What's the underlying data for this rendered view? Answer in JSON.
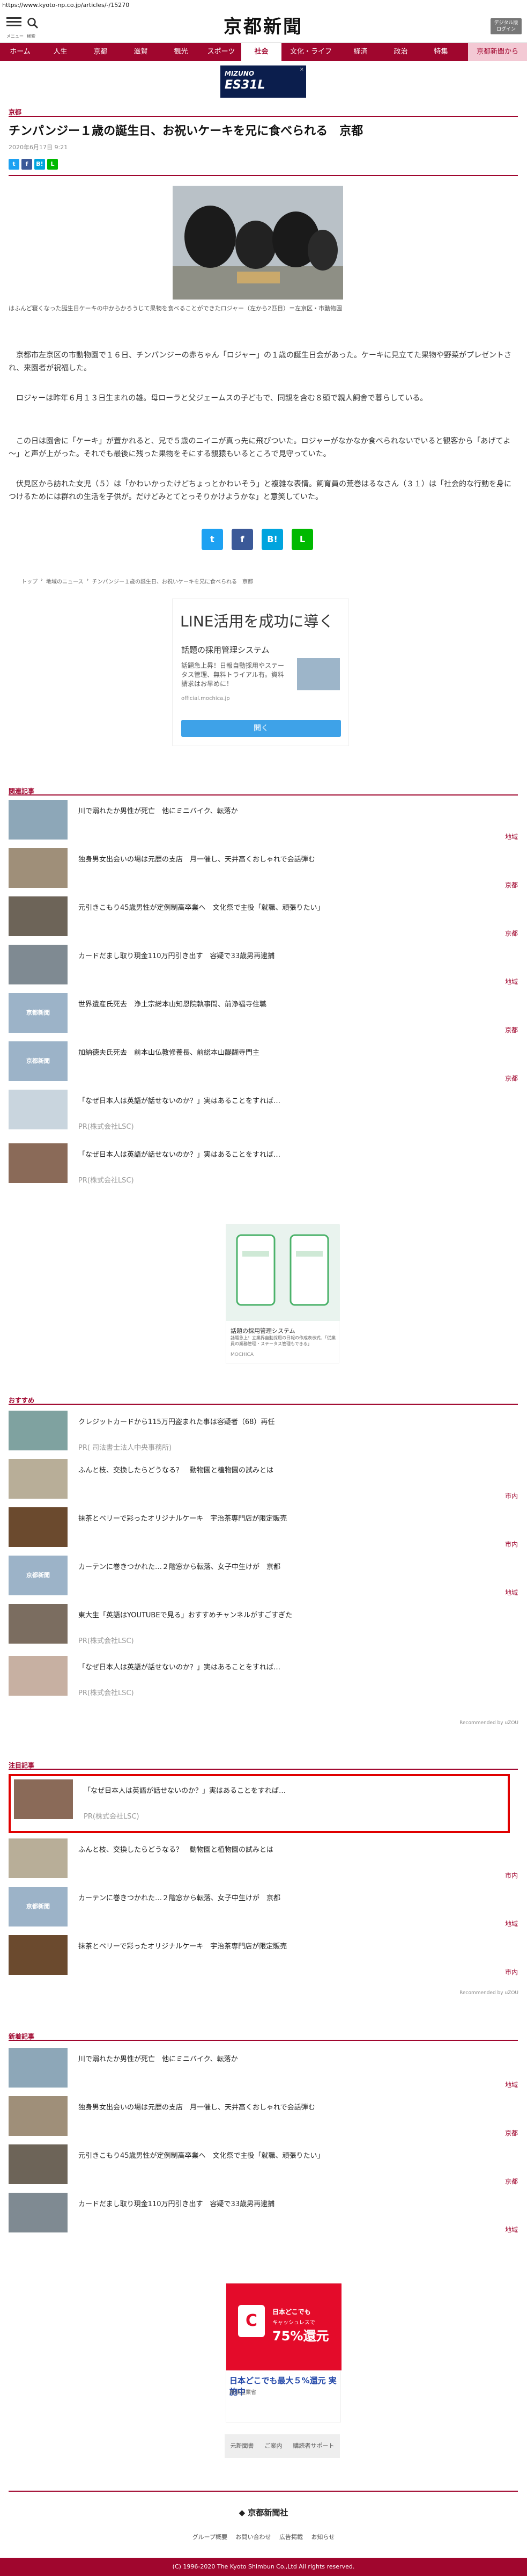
{
  "url": "https://www.kyoto-np.co.jp/articles/-/15270",
  "header": {
    "menu_label": "メニュー",
    "search_label": "検索",
    "logo_text": "京都新聞",
    "digital_label_1": "デジタル版",
    "digital_label_2": "ログイン"
  },
  "nav": {
    "items": [
      "ホーム",
      "人生",
      "京都",
      "滋賀",
      "観光",
      "スポーツ",
      "社会",
      "文化・ライフ",
      "経済",
      "政治",
      "特集"
    ],
    "special": "京都新聞から"
  },
  "top_ad": {
    "brand": "MIZUNO",
    "model": "ES31L",
    "close": "×"
  },
  "article": {
    "section": "京都",
    "title": "チンパンジー１歳の誕生日、お祝いケーキを兄に食べられる　京都",
    "date": "2020年6月17日 9:21",
    "caption": "はふんど寝くなった誕生日ケーキの中からかろうじて果物を食べることができたロジャー（左から2匹目）＝左京区・市動物園",
    "paragraphs": [
      "　京都市左京区の市動物園で１６日、チンパンジーの赤ちゃん「ロジャー」の１歳の誕生日会があった。ケーキに見立てた果物や野菜がプレゼントされ、来園者が祝福した。",
      "　ロジャーは昨年６月１３日生まれの雄。母ローラと父ジェームスの子どもで、同親を含む８頭で親人飼舎で暮らしている。",
      "　この日は園舎に「ケーキ」が置かれると、兄で５歳のニイニが真っ先に飛びついた。ロジャーがなかなか食べられないでいると観客から「あげてよ～」と声が上がった。それでも最後に残った果物をそにする親猿もいるところで見守っていた。",
      "　伏見区から訪れた女児（５）は「かわいかったけどちょっとかわいそう」と複雑な表情。飼育員の荒巻はるなさん（３１）は「社会的な行動を身につけるためには群れの生活を子供が。だけどみとてとっそりかけようかな」と意笑していた。"
    ],
    "share_small": [
      "t",
      "f",
      "B!",
      "L"
    ],
    "share_large": [
      "t",
      "f",
      "B!",
      "L"
    ]
  },
  "breadcrumb": [
    "トップ",
    "地域のニュース",
    "チンパンジー１歳の誕生日、お祝いケーキを兄に食べられる　京都"
  ],
  "ad_line": {
    "headline": "LINE活用を成功に導く",
    "sub": "話題の採用管理システム",
    "desc": "話題急上昇！日報自動採用やステータス管理、無料トライアル有。資料請求はお早めに！",
    "domain": "official.mochica.jp",
    "button": "開く"
  },
  "related": {
    "title": "関連記事",
    "items": [
      {
        "title": "川で溺れたか男性が死亡　他にミニバイク、転落か",
        "category": "地域"
      },
      {
        "title": "独身男女出会いの場は元歴の支店　月一催し、天井高くおしゃれで会話弾む",
        "category": "京都"
      },
      {
        "title": "元引きこもり45歳男性が定例制高卒業へ　文化祭で主役「就職、頑張りたい」",
        "category": "京都"
      },
      {
        "title": "カードだまし取り現金110万円引き出す　容疑で33歳男再逮捕",
        "category": "地域"
      },
      {
        "title": "世界遺産氏死去　浄土宗総本山知恩院執事問、前浄福寺住職",
        "category": "京都"
      },
      {
        "title": "加納徳夫氏死去　前本山仏教修養長、前総本山醍醐寺門主",
        "category": "京都"
      },
      {
        "title": "「なぜ日本人は英語が話せないのか？」実はあることをすれば…",
        "pr": "PR(株式会社LSC)"
      },
      {
        "title": "「なぜ日本人は英語が話せないのか？」実はあることをすれば…",
        "pr": "PR(株式会社LSC)"
      }
    ],
    "logo_text": "京都新聞"
  },
  "ad_app": {
    "t1": "話題の採用管理システム",
    "t2": "話題急上！立業界自動採用の日報の作成表示式、「従業員の業務管理・ステータス管理もできる」",
    "t3": "MOCHICA"
  },
  "recommend": {
    "title": "おすすめ",
    "items": [
      {
        "title": "クレジットカードから115万円盗まれた事は容疑者（68）再任",
        "pr": "PR( 司法書士法人中央事務所)"
      },
      {
        "title": "ふんと枝、交換したらどうなる？　動物園と植物園の試みとは",
        "category": "市内"
      },
      {
        "title": "抹茶とベリーで彩ったオリジナルケーキ　宇治茶専門店が限定販売",
        "category": "市内"
      },
      {
        "title": "カーテンに巻きつかれた…２階窓から転落、女子中生けが　京都",
        "category": "地域"
      },
      {
        "title": "東大生「英語はYOUTUBEで見る」おすすめチャンネルがすごすぎた",
        "pr": "PR(株式会社LSC)"
      },
      {
        "title": "「なぜ日本人は英語が話せないのか？」実はあることをすれば…",
        "pr": "PR(株式会社LSC)"
      }
    ],
    "recommended_by": "Recommended by uZOU"
  },
  "featured": {
    "title": "注目記事",
    "items": [
      {
        "title": "「なぜ日本人は英語が話せないのか？」実はあることをすれば…",
        "pr": "PR(株式会社LSC)"
      },
      {
        "title": "ふんと枝、交換したらどうなる？　動物園と植物園の試みとは",
        "category": "市内"
      },
      {
        "title": "カーテンに巻きつかれた…２階窓から転落、女子中生けが　京都",
        "category": "地域"
      },
      {
        "title": "抹茶とベリーで彩ったオリジナルケーキ　宇治茶専門店が限定販売",
        "category": "市内"
      }
    ],
    "recommended_by": "Recommended by uZOU"
  },
  "latest": {
    "title": "新着記事",
    "items": [
      {
        "title": "川で溺れたか男性が死亡　他にミニバイク、転落か",
        "category": "地域"
      },
      {
        "title": "独身男女出会いの場は元歴の支店　月一催し、天井高くおしゃれで会話弾む",
        "category": "京都"
      },
      {
        "title": "元引きこもり45歳男性が定例制高卒業へ　文化祭で主役「就職、頑張りたい」",
        "category": "京都"
      },
      {
        "title": "カードだまし取り現金110万円引き出す　容疑で33歳男再逮捕",
        "category": "地域"
      }
    ]
  },
  "ad_bottom": {
    "t1": "日本どこでも",
    "t2": "キャッシュレスで",
    "t3": "75%還元",
    "t4": "日本どこでも最大５%還元 実施中",
    "t5": "経済産業省"
  },
  "footer": {
    "links": [
      "元新聞書",
      "ご案内",
      "購読者サポート"
    ],
    "logo": "京都新聞社",
    "links2": [
      "グループ概要",
      "お問い合わせ",
      "広告掲載",
      "お知らせ"
    ],
    "copyright": "(C) 1996-2020 The Kyoto Shimbun Co.,Ltd All rights reserved."
  },
  "colors": {
    "brand": "#a0062e",
    "highlight": "#e00000"
  }
}
